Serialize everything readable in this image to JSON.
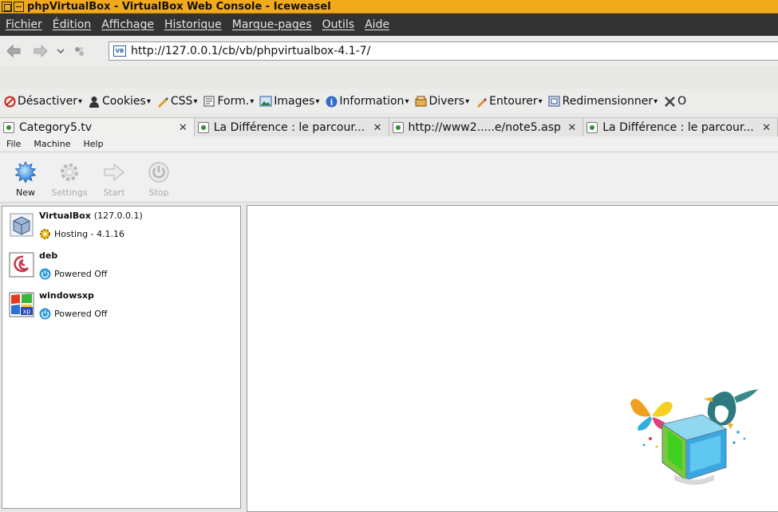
{
  "window": {
    "title": "phpVirtualBox - VirtualBox Web Console - Iceweasel"
  },
  "menu": [
    "Fichier",
    "Édition",
    "Affichage",
    "Historique",
    "Marque-pages",
    "Outils",
    "Aide"
  ],
  "navigation": {
    "url": "http://127.0.0.1/cb/vb/phpvirtualbox-4.1-7/"
  },
  "devtoolbar": [
    {
      "label": "Désactiver",
      "icon": "disable-icon"
    },
    {
      "label": "Cookies",
      "icon": "person-icon"
    },
    {
      "label": "CSS",
      "icon": "pencil-icon"
    },
    {
      "label": "Form.",
      "icon": "form-icon"
    },
    {
      "label": "Images",
      "icon": "image-icon"
    },
    {
      "label": "Information",
      "icon": "info-icon"
    },
    {
      "label": "Divers",
      "icon": "misc-icon"
    },
    {
      "label": "Entourer",
      "icon": "outline-icon"
    },
    {
      "label": "Redimensionner",
      "icon": "resize-icon"
    },
    {
      "label": "O",
      "icon": "tools-icon"
    }
  ],
  "tabs": [
    {
      "label": "Category5.tv"
    },
    {
      "label": "La Différence : le parcour..."
    },
    {
      "label": "http://www2.....e/note5.asp"
    },
    {
      "label": "La Différence : le parcour..."
    }
  ],
  "app_menu": [
    "File",
    "Machine",
    "Help"
  ],
  "app_toolbar": [
    {
      "label": "New",
      "enabled": true
    },
    {
      "label": "Settings",
      "enabled": false
    },
    {
      "label": "Start",
      "enabled": false
    },
    {
      "label": "Stop",
      "enabled": false
    }
  ],
  "vms": [
    {
      "name": "VirtualBox",
      "host": "(127.0.0.1)",
      "state": "Hosting - 4.1.16"
    },
    {
      "name": "deb",
      "state": "Powered Off"
    },
    {
      "name": "windowsxp",
      "state": "Powered Off"
    }
  ]
}
